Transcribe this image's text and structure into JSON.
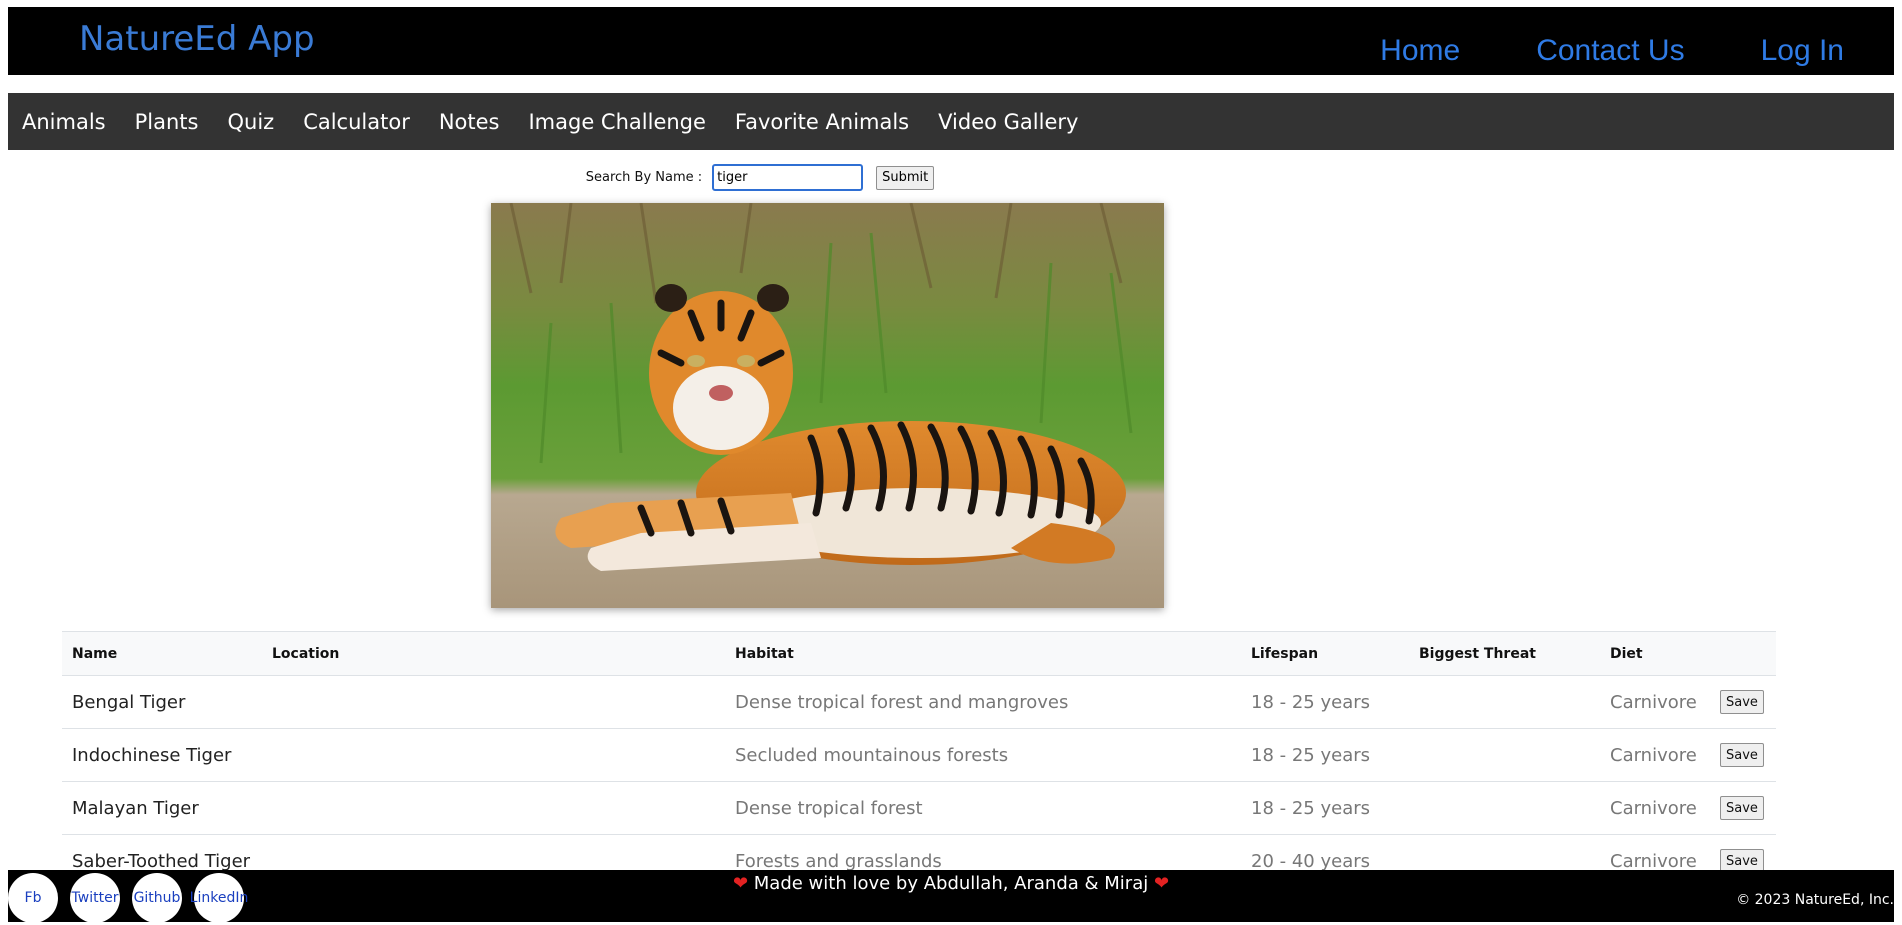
{
  "header": {
    "app_title": "NatureEd App",
    "nav": [
      {
        "label": "Home"
      },
      {
        "label": "Contact Us"
      },
      {
        "label": "Log In"
      }
    ]
  },
  "menu": {
    "items": [
      {
        "label": "Animals"
      },
      {
        "label": "Plants"
      },
      {
        "label": "Quiz"
      },
      {
        "label": "Calculator"
      },
      {
        "label": "Notes"
      },
      {
        "label": "Image Challenge"
      },
      {
        "label": "Favorite Animals"
      },
      {
        "label": "Video Gallery"
      }
    ]
  },
  "search": {
    "label": "Search By Name :",
    "value": "tiger",
    "submit_label": "Submit"
  },
  "table": {
    "headers": [
      "Name",
      "Location",
      "Habitat",
      "Lifespan",
      "Biggest Threat",
      "Diet"
    ],
    "rows": [
      {
        "name": "Bengal Tiger",
        "location": "",
        "habitat": "Dense tropical forest and mangroves",
        "lifespan": "18 - 25 years",
        "threat": "",
        "diet": "Carnivore",
        "action": "Save"
      },
      {
        "name": "Indochinese Tiger",
        "location": "",
        "habitat": "Secluded mountainous forests",
        "lifespan": "18 - 25 years",
        "threat": "",
        "diet": "Carnivore",
        "action": "Save"
      },
      {
        "name": "Malayan Tiger",
        "location": "",
        "habitat": "Dense tropical forest",
        "lifespan": "18 - 25 years",
        "threat": "",
        "diet": "Carnivore",
        "action": "Save"
      },
      {
        "name": "Saber-Toothed Tiger",
        "location": "",
        "habitat": "Forests and grasslands",
        "lifespan": "20 - 40 years",
        "threat": "",
        "diet": "Carnivore",
        "action": "Save"
      }
    ]
  },
  "footer": {
    "social": [
      {
        "label": "Fb"
      },
      {
        "label": "Twitter"
      },
      {
        "label": "Github"
      },
      {
        "label": "LinkedIn"
      }
    ],
    "made_with": "Made with love by Abdullah, Aranda & Miraj",
    "heart_icon": "heart-icon",
    "copyright": "© 2023 NatureEd, Inc."
  }
}
